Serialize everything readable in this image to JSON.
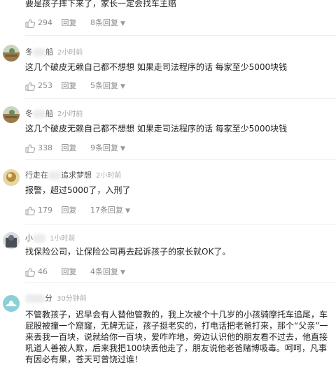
{
  "top_comment": {
    "text": "要是孩子摔下来了，家长一定会找车主赔",
    "likes": "294",
    "reply_label": "回复",
    "replies_label": "8条回复"
  },
  "comments": [
    {
      "user_prefix": "冬",
      "user_suffix": "船",
      "time": "2小时前",
      "text": "这几个破皮无赖自己都不想想 如果走司法程序的话 每家至少5000块钱",
      "likes": "253",
      "reply_label": "回复",
      "replies_label": "5条回复"
    },
    {
      "user_prefix": "冬",
      "user_suffix": "船",
      "time": "2小时前",
      "text": "这几个破皮无赖自己都不想想 如果走司法程序的话 每家至少5000块钱",
      "likes": "338",
      "reply_label": "回复",
      "replies_label": "9条回复"
    },
    {
      "user_prefix": "行走在",
      "user_suffix": "追求梦想",
      "time": "2小时前",
      "text": "报警，超过5000了，入刑了",
      "likes": "179",
      "reply_label": "回复",
      "replies_label": "17条回复"
    },
    {
      "user_prefix": "小",
      "user_suffix": "",
      "time": "1小时前",
      "text": "找保险公司，让保险公司再去起诉孩子的家长就OK了。",
      "likes": "46",
      "reply_label": "回复",
      "replies_label": "4条回复"
    },
    {
      "user_prefix": "",
      "user_suffix": "分",
      "time": "30分钟前",
      "text": "不管教孩子，迟早会有人替他管教的，我上次被个十几岁的小孩骑摩托车追尾，车屁股被撞一个窟窿，无牌无证，孩子挺老实的，打电话把老爸打来，那个“父亲”一来丢我一百块，说就给你一百块，爱咋咋地，旁边认识他的朋友看不过去，他直接吼道人善被人欺，后来我把100块丢他走了，朋友说他老爸赌博吸毒。呵呵，凡事有因必有果，苍天可曾饶过谁！"
    }
  ],
  "colors": {
    "text": "#222222",
    "meta": "#888888",
    "divider": "#ececec"
  },
  "icons": {
    "like": "thumbs-up-icon",
    "caret": "chevron-down-icon"
  }
}
